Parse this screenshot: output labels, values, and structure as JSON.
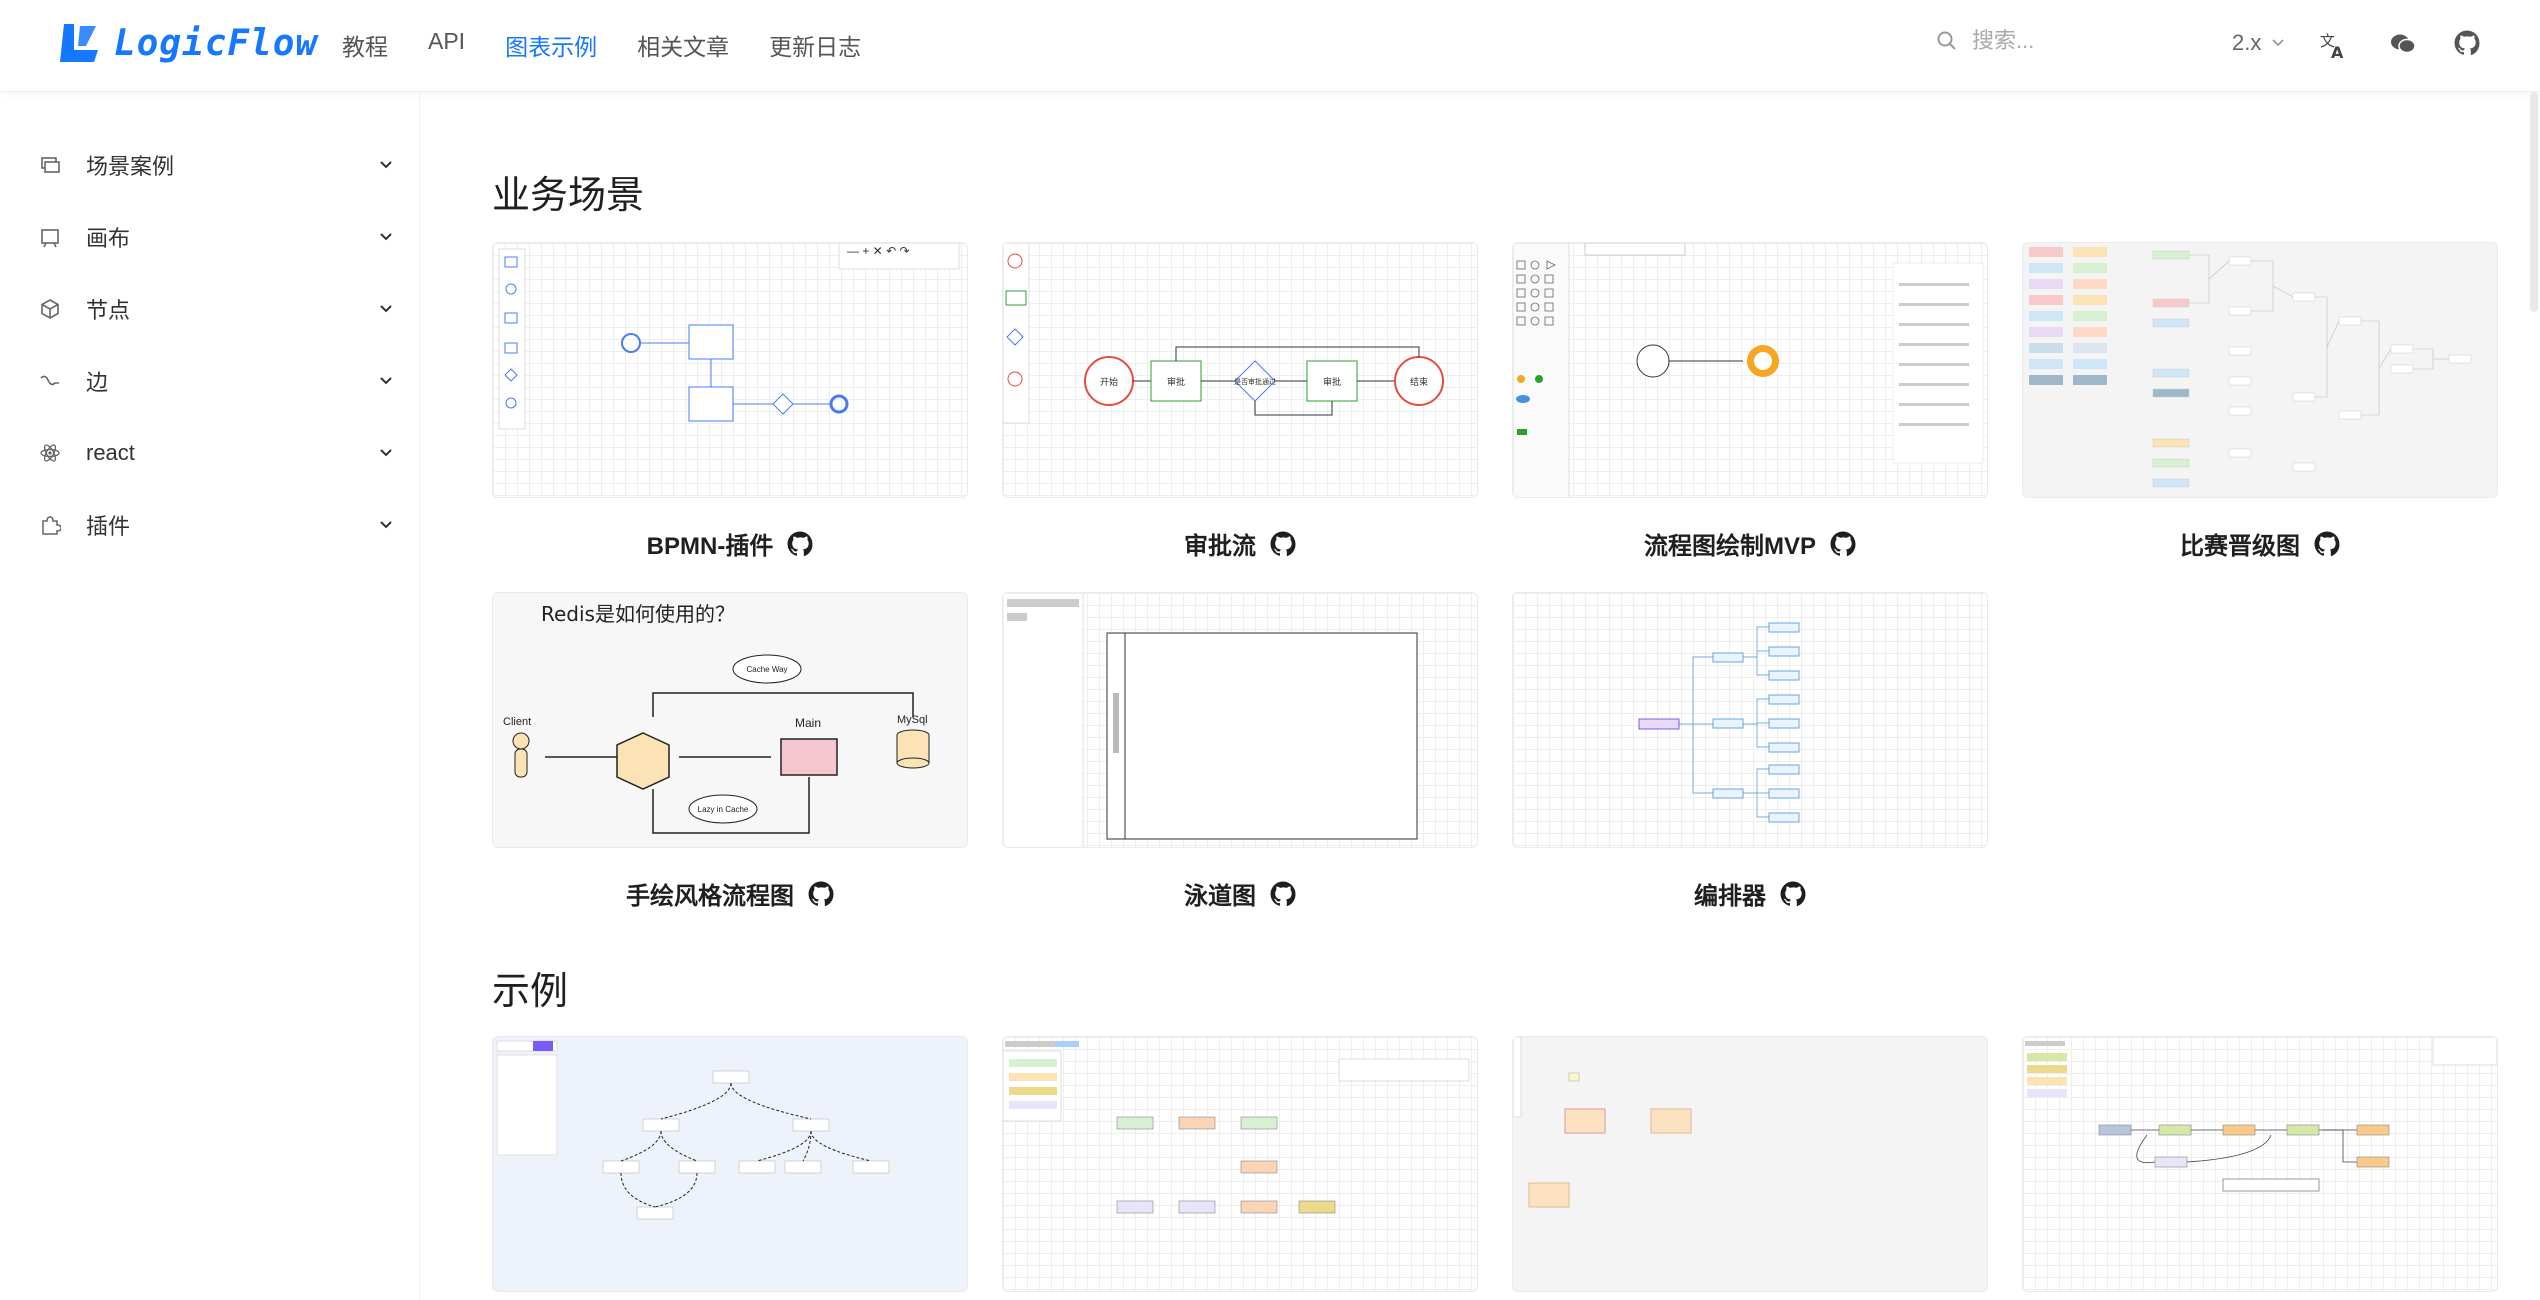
{
  "header": {
    "logo_text": "LogicFlow",
    "nav": [
      {
        "label": "教程",
        "active": false
      },
      {
        "label": "API",
        "active": false
      },
      {
        "label": "图表示例",
        "active": true
      },
      {
        "label": "相关文章",
        "active": false
      },
      {
        "label": "更新日志",
        "active": false
      }
    ],
    "search_placeholder": "搜索...",
    "version": "2.x"
  },
  "sidebar": {
    "items": [
      {
        "label": "场景案例",
        "icon": "layers-icon"
      },
      {
        "label": "画布",
        "icon": "canvas-icon"
      },
      {
        "label": "节点",
        "icon": "cube-icon"
      },
      {
        "label": "边",
        "icon": "edge-icon"
      },
      {
        "label": "react",
        "icon": "react-icon"
      },
      {
        "label": "插件",
        "icon": "puzzle-icon"
      }
    ]
  },
  "sections": [
    {
      "title": "业务场景",
      "cards": [
        {
          "title": "BPMN-插件"
        },
        {
          "title": "审批流"
        },
        {
          "title": "流程图绘制MVP"
        },
        {
          "title": "比赛晋级图"
        },
        {
          "title": "手绘风格流程图"
        },
        {
          "title": "泳道图"
        },
        {
          "title": "编排器"
        }
      ]
    },
    {
      "title": "示例",
      "cards": [
        {
          "title": ""
        },
        {
          "title": ""
        },
        {
          "title": ""
        },
        {
          "title": ""
        }
      ]
    }
  ],
  "sketch": {
    "heading": "Redis是如何使用的？",
    "client": "Client",
    "main": "Main",
    "mysql": "MySql",
    "cache_way": "Cache Way",
    "lazy_cache": "Lazy in Cache"
  },
  "approval": {
    "start": "开始",
    "end": "结束",
    "step1": "审批",
    "decision": "是否审批通过",
    "step2": "审批"
  },
  "colors": {
    "accent": "#1677ff",
    "text": "#1f1f1f"
  }
}
